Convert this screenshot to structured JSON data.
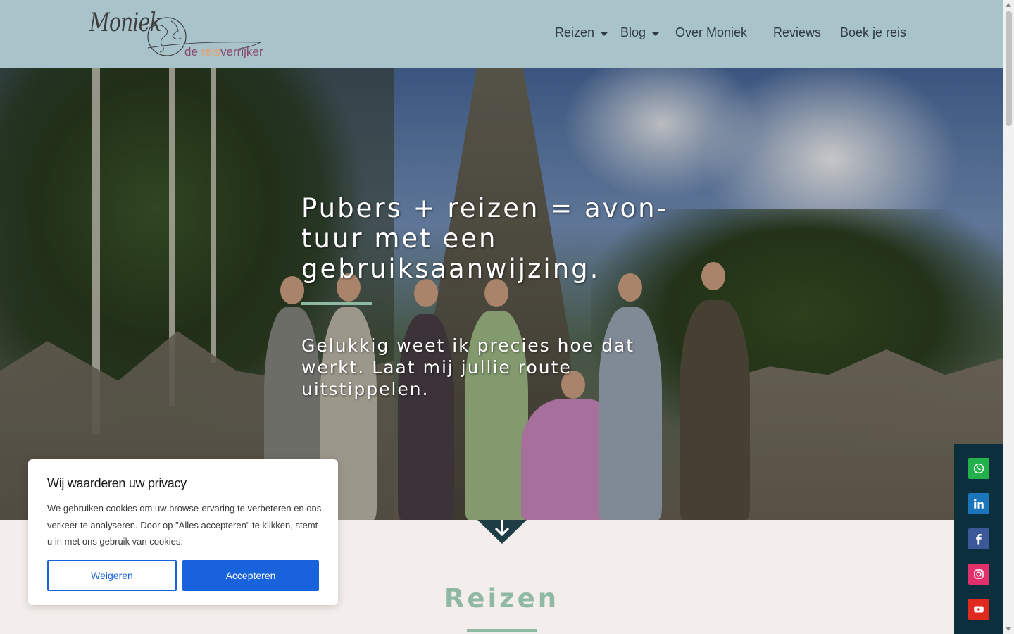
{
  "header": {
    "logo": {
      "script": "Moniek",
      "tag_1": "de ",
      "tag_2": "reis",
      "tag_3": "verrijker"
    },
    "nav": [
      {
        "label": "Reizen",
        "has_dropdown": true
      },
      {
        "label": "Blog",
        "has_dropdown": true
      },
      {
        "label": "Over Moniek",
        "has_dropdown": false
      },
      {
        "label": "Reviews",
        "has_dropdown": false
      },
      {
        "label": "Boek je reis",
        "has_dropdown": false
      }
    ]
  },
  "hero": {
    "title": "Pubers + reizen = avon-tuur met een gebruiksaanwijzing.",
    "subtitle": "Gelukkig weet ik precies hoe dat werkt. Laat mij jullie route uitstippelen.",
    "scroll_icon": "arrow-down-icon"
  },
  "section": {
    "title": "Reizen"
  },
  "cookie": {
    "title": "Wij waarderen uw privacy",
    "text": "We gebruiken cookies om uw browse-ervaring te verbeteren en ons verkeer te analyseren. Door op \"Alles accepteren\" te klikken, stemt u in met ons gebruik van cookies.",
    "reject_label": "Weigeren",
    "accept_label": "Accepteren"
  },
  "social": [
    {
      "name": "whatsapp-icon",
      "color": "#22b14c"
    },
    {
      "name": "linkedin-icon",
      "color": "#1b75bb"
    },
    {
      "name": "facebook-icon",
      "color": "#3b5998"
    },
    {
      "name": "instagram-icon",
      "color": "#e1306c"
    },
    {
      "name": "youtube-icon",
      "color": "#e02a20"
    }
  ],
  "colors": {
    "header_bg": "#a9c3cb",
    "accent": "#8fb9a3",
    "page_bg": "#f3eeeb",
    "social_bar": "#0b2f3c",
    "cookie_button": "#1863dc"
  }
}
